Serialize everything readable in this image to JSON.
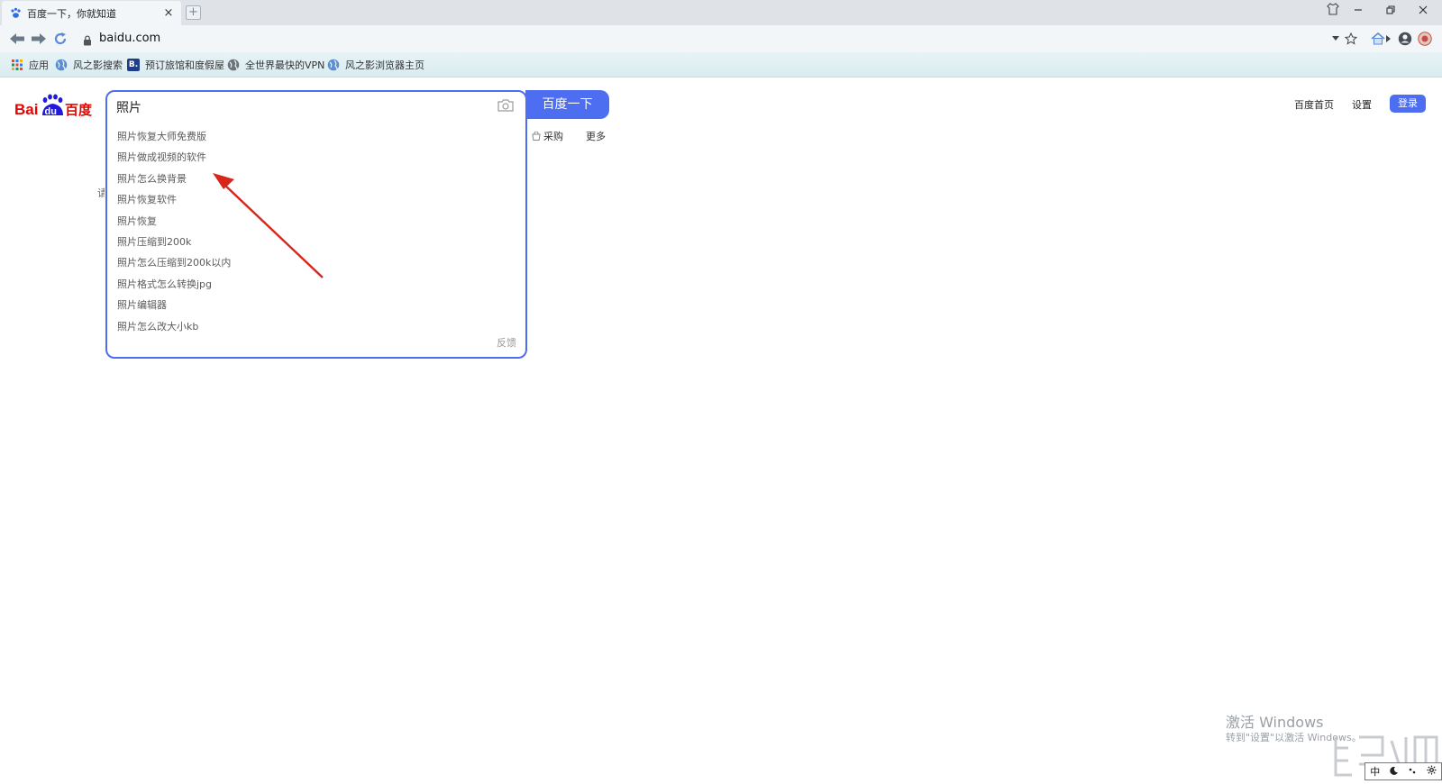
{
  "tab": {
    "title": "百度一下，你就知道",
    "close": "×",
    "new_tab": "+"
  },
  "address": {
    "url": "baidu.com"
  },
  "bookmarks": [
    {
      "label": "应用",
      "icon": "apps-icon"
    },
    {
      "label": "风之影搜索",
      "icon": "globe-icon"
    },
    {
      "label": "预订旅馆和度假屋",
      "icon": "booking-icon",
      "badge": "B."
    },
    {
      "label": "全世界最快的VPN",
      "icon": "globe-icon"
    },
    {
      "label": "风之影浏览器主页",
      "icon": "globe-icon"
    }
  ],
  "logo": {
    "left": "Bai",
    "paw": "du",
    "right": "百度"
  },
  "search": {
    "value": "照片",
    "button": "百度一下",
    "suggestions": [
      "照片恢复大师免费版",
      "照片做成视频的软件",
      "照片怎么换背景",
      "照片恢复软件",
      "照片恢复",
      "照片压缩到200k",
      "照片怎么压缩到200k以内",
      "照片格式怎么转换jpg",
      "照片编辑器",
      "照片怎么改大小kb"
    ],
    "feedback": "反馈"
  },
  "subnav": {
    "purchase": "采购",
    "more": "更多"
  },
  "stray_char": "请",
  "top_links": {
    "home": "百度首页",
    "settings": "设置",
    "login": "登录"
  },
  "watermark": {
    "line1": "激活 Windows",
    "line2": "转到\"设置\"以激活 Windows。"
  },
  "ime": {
    "lang": "中"
  },
  "colors": {
    "accent": "#4e6ef2",
    "logo_red": "#e10602",
    "logo_blue": "#2319dc",
    "arrow": "#d9261c"
  }
}
